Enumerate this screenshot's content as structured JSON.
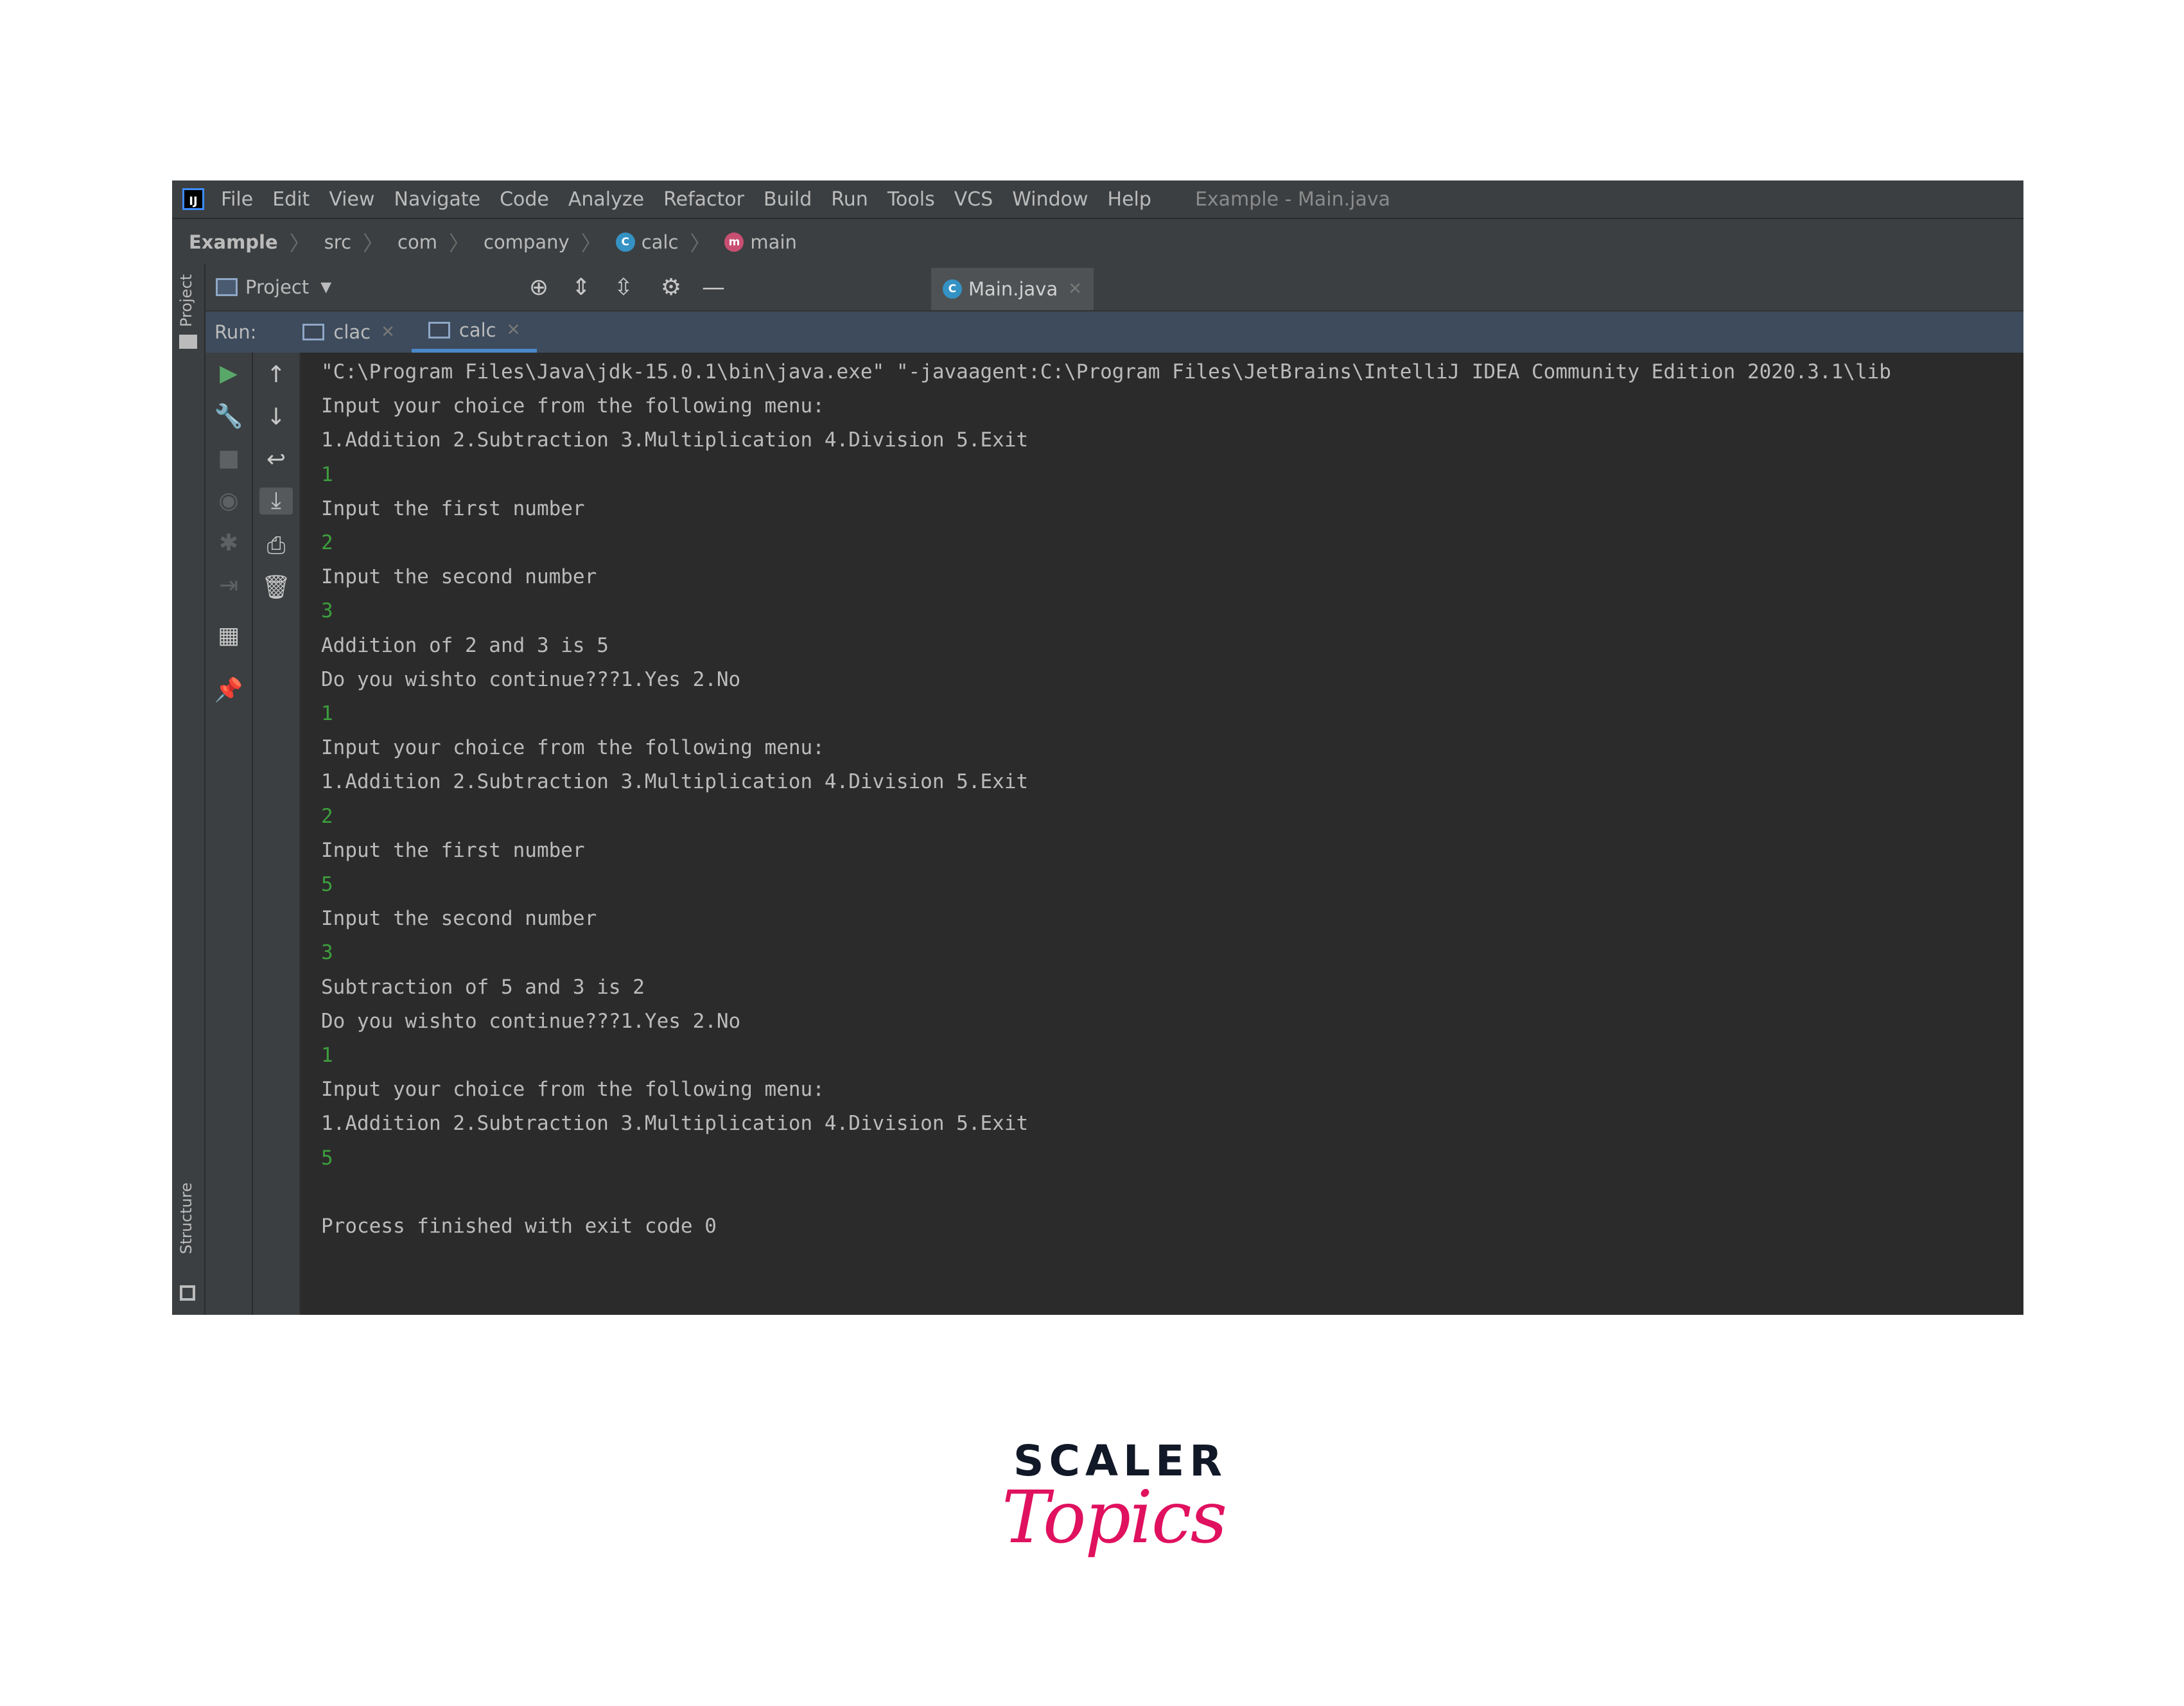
{
  "menubar": {
    "items": [
      "File",
      "Edit",
      "View",
      "Navigate",
      "Code",
      "Analyze",
      "Refactor",
      "Build",
      "Run",
      "Tools",
      "VCS",
      "Window",
      "Help"
    ],
    "window_title": "Example - Main.java",
    "logo_letters": "IJ"
  },
  "breadcrumbs": [
    "Example",
    "src",
    "com",
    "company",
    "calc",
    "main"
  ],
  "tool_window": {
    "project_label": "Project",
    "vertical_tab_project": "Project",
    "vertical_tab_structure": "Structure",
    "editor_tab": "Main.java"
  },
  "run_panel": {
    "label": "Run:",
    "tabs": [
      "clac",
      "calc"
    ],
    "active_tab": "calc"
  },
  "console": {
    "lines": [
      {
        "text": "\"C:\\Program Files\\Java\\jdk-15.0.1\\bin\\java.exe\" \"-javaagent:C:\\Program Files\\JetBrains\\IntelliJ IDEA Community Edition 2020.3.1\\lib",
        "input": false
      },
      {
        "text": "Input your choice from the following menu:",
        "input": false
      },
      {
        "text": "1.Addition 2.Subtraction 3.Multiplication 4.Division 5.Exit",
        "input": false
      },
      {
        "text": "1",
        "input": true
      },
      {
        "text": "Input the first number",
        "input": false
      },
      {
        "text": "2",
        "input": true
      },
      {
        "text": "Input the second number",
        "input": false
      },
      {
        "text": "3",
        "input": true
      },
      {
        "text": "Addition of 2 and 3 is 5",
        "input": false
      },
      {
        "text": "Do you wishto continue???1.Yes 2.No",
        "input": false
      },
      {
        "text": "1",
        "input": true
      },
      {
        "text": "Input your choice from the following menu:",
        "input": false
      },
      {
        "text": "1.Addition 2.Subtraction 3.Multiplication 4.Division 5.Exit",
        "input": false
      },
      {
        "text": "2",
        "input": true
      },
      {
        "text": "Input the first number",
        "input": false
      },
      {
        "text": "5",
        "input": true
      },
      {
        "text": "Input the second number",
        "input": false
      },
      {
        "text": "3",
        "input": true
      },
      {
        "text": "Subtraction of 5 and 3 is 2",
        "input": false
      },
      {
        "text": "Do you wishto continue???1.Yes 2.No",
        "input": false
      },
      {
        "text": "1",
        "input": true
      },
      {
        "text": "Input your choice from the following menu:",
        "input": false
      },
      {
        "text": "1.Addition 2.Subtraction 3.Multiplication 4.Division 5.Exit",
        "input": false
      },
      {
        "text": "5",
        "input": true
      },
      {
        "text": "",
        "input": false
      },
      {
        "text": "Process finished with exit code 0",
        "input": false
      }
    ]
  },
  "brand": {
    "line1": "SCALER",
    "line2": "Topics"
  }
}
